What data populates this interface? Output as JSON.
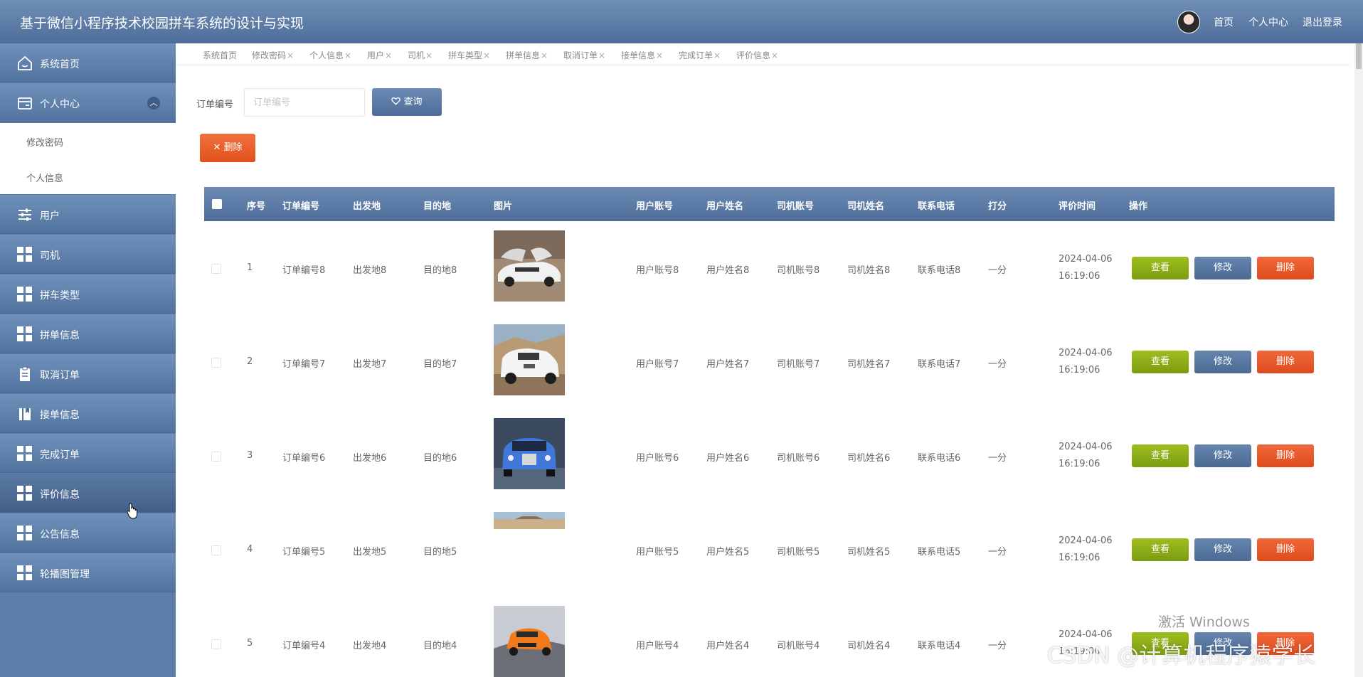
{
  "header": {
    "title": "基于微信小程序技术校园拼车系统的设计与实现",
    "nav": [
      "首页",
      "个人中心",
      "退出登录"
    ]
  },
  "sidebar": {
    "items": [
      {
        "label": "系统首页",
        "icon": "home-icon"
      },
      {
        "label": "个人中心",
        "icon": "card-icon",
        "expanded": true,
        "sub": [
          "修改密码",
          "个人信息"
        ]
      },
      {
        "label": "用户",
        "icon": "sliders-icon"
      },
      {
        "label": "司机",
        "icon": "grid-icon"
      },
      {
        "label": "拼车类型",
        "icon": "grid-icon"
      },
      {
        "label": "拼单信息",
        "icon": "grid-icon"
      },
      {
        "label": "取消订单",
        "icon": "clipboard-icon"
      },
      {
        "label": "接单信息",
        "icon": "book-icon"
      },
      {
        "label": "完成订单",
        "icon": "grid-icon"
      },
      {
        "label": "评价信息",
        "icon": "grid-icon",
        "active": true
      },
      {
        "label": "公告信息",
        "icon": "grid-icon"
      },
      {
        "label": "轮播图管理",
        "icon": "grid-icon"
      }
    ]
  },
  "tabs": [
    {
      "label": "系统首页",
      "closable": false
    },
    {
      "label": "修改密码",
      "closable": true
    },
    {
      "label": "个人信息",
      "closable": true
    },
    {
      "label": "用户",
      "closable": true
    },
    {
      "label": "司机",
      "closable": true
    },
    {
      "label": "拼车类型",
      "closable": true
    },
    {
      "label": "拼单信息",
      "closable": true
    },
    {
      "label": "取消订单",
      "closable": true
    },
    {
      "label": "接单信息",
      "closable": true
    },
    {
      "label": "完成订单",
      "closable": true
    },
    {
      "label": "评价信息",
      "closable": true
    }
  ],
  "search": {
    "label": "订单编号",
    "placeholder": "订单编号",
    "value": "",
    "button": "查询"
  },
  "toolbar": {
    "delete_label": "删除"
  },
  "table": {
    "columns": [
      "序号",
      "订单编号",
      "出发地",
      "目的地",
      "图片",
      "用户账号",
      "用户姓名",
      "司机账号",
      "司机姓名",
      "联系电话",
      "打分",
      "评价时间",
      "操作"
    ],
    "actions": {
      "view": "查看",
      "edit": "修改",
      "delete": "删除"
    },
    "rows": [
      {
        "idx": "1",
        "order": "订单编号8",
        "from": "出发地8",
        "to": "目的地8",
        "user_acc": "用户账号8",
        "user_name": "用户姓名8",
        "drv_acc": "司机账号8",
        "drv_name": "司机姓名8",
        "phone": "联系电话8",
        "score": "一分",
        "date": "2024-04-06",
        "time": "16:19:06",
        "image": "white-sports-car"
      },
      {
        "idx": "2",
        "order": "订单编号7",
        "from": "出发地7",
        "to": "目的地7",
        "user_acc": "用户账号7",
        "user_name": "用户姓名7",
        "drv_acc": "司机账号7",
        "drv_name": "司机姓名7",
        "phone": "联系电话7",
        "score": "一分",
        "date": "2024-04-06",
        "time": "16:19:06",
        "image": "white-suv"
      },
      {
        "idx": "3",
        "order": "订单编号6",
        "from": "出发地6",
        "to": "目的地6",
        "user_acc": "用户账号6",
        "user_name": "用户姓名6",
        "drv_acc": "司机账号6",
        "drv_name": "司机姓名6",
        "phone": "联系电话6",
        "score": "一分",
        "date": "2024-04-06",
        "time": "16:19:06",
        "image": "blue-luxury-car"
      },
      {
        "idx": "4",
        "order": "订单编号5",
        "from": "出发地5",
        "to": "目的地5",
        "user_acc": "用户账号5",
        "user_name": "用户姓名5",
        "drv_acc": "司机账号5",
        "drv_name": "司机姓名5",
        "phone": "联系电话5",
        "score": "一分",
        "date": "2024-04-06",
        "time": "16:19:06",
        "image": "partial-desert"
      },
      {
        "idx": "5",
        "order": "订单编号4",
        "from": "出发地4",
        "to": "目的地4",
        "user_acc": "用户账号4",
        "user_name": "用户姓名4",
        "drv_acc": "司机账号4",
        "drv_name": "司机姓名4",
        "phone": "联系电话4",
        "score": "一分",
        "date": "2024-04-06",
        "time": "16:19:06",
        "image": "orange-car"
      }
    ]
  },
  "watermarks": {
    "windows": "激活 Windows",
    "csdn": "CSDN @计算机程序猿学长"
  },
  "colors": {
    "header": "#5b7ca7",
    "view_button": "#8cac18",
    "edit_button": "#56769f",
    "delete_button": "#e85a2a"
  }
}
